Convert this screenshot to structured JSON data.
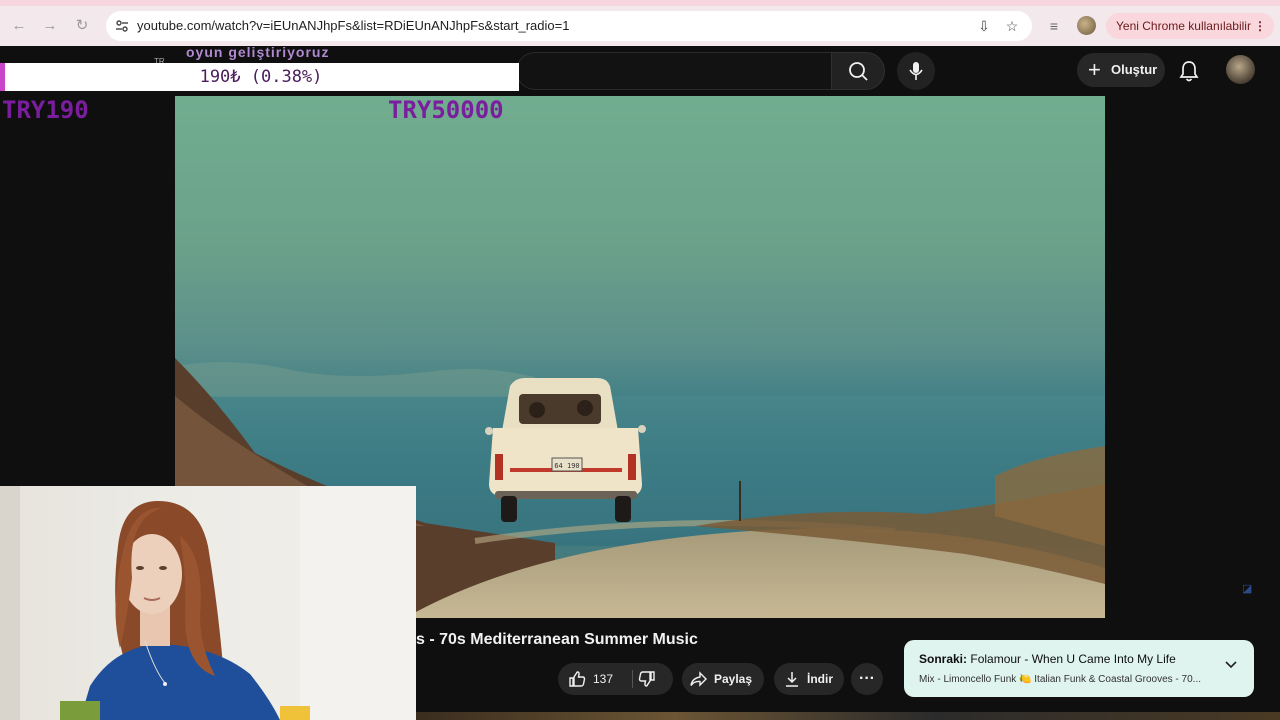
{
  "browser": {
    "url": "youtube.com/watch?v=iEUnANJhpFs&list=RDiEUnANJhpFs&start_radio=1",
    "update_label": "Yeni Chrome kullanılabilir",
    "icons": [
      "back-arrow-icon",
      "forward-arrow-icon",
      "reload-icon",
      "site-info-icon",
      "install-app-icon",
      "bookmark-star-icon",
      "tab-search-icon",
      "profile-icon",
      "menu-dots-icon"
    ]
  },
  "header": {
    "create_label": "Oluştur",
    "icons": [
      "search-icon",
      "mic-icon",
      "plus-icon",
      "bell-icon",
      "avatar"
    ]
  },
  "overlay": {
    "goal_title": "oyun geliştiriyoruz",
    "currency_badge": "TR",
    "progress_text": "190₺ (0.38%)",
    "progress_fraction": 0.0038,
    "start_amount": "TRY190",
    "goal_amount": "TRY50000",
    "accent_color": "#c844c8"
  },
  "video": {
    "title": "s - 70s Mediterranean Summer Music",
    "plate_text": "64 190"
  },
  "actions": {
    "like_count": "137",
    "share_label": "Paylaş",
    "download_label": "İndir",
    "more_label": "···"
  },
  "next_up": {
    "prefix": "Sonraki:",
    "title": "Folamour - When U Came Into My Life",
    "playlist": "Mix - Limoncello Funk 🍋 Italian Funk & Coastal Grooves - 70..."
  }
}
